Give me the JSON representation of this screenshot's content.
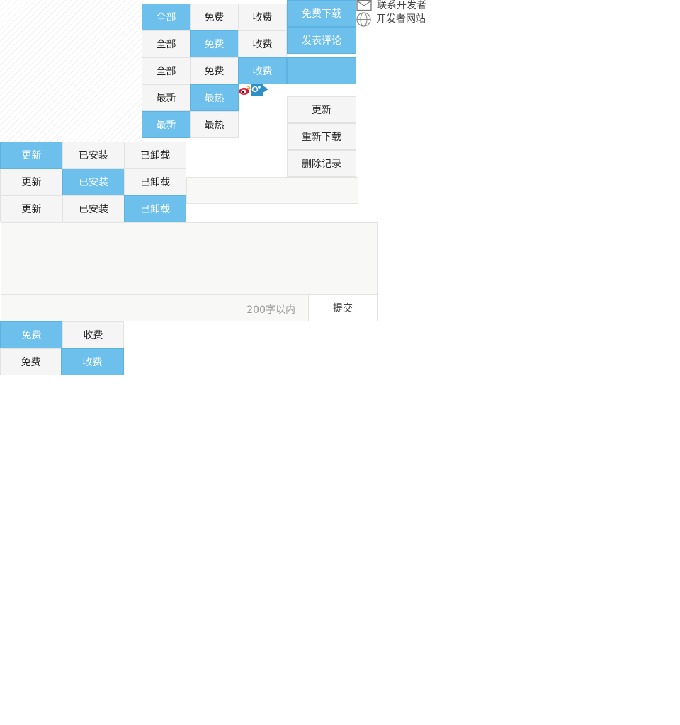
{
  "filter_all": {
    "rows": [
      {
        "all": "全部",
        "free": "免费",
        "paid": "收费",
        "active": "all"
      },
      {
        "all": "全部",
        "free": "免费",
        "paid": "收费",
        "active": "free"
      },
      {
        "all": "全部",
        "free": "免费",
        "paid": "收费",
        "active": "paid"
      }
    ]
  },
  "sort_tabs": {
    "rows": [
      {
        "newest": "最新",
        "hottest": "最热",
        "active": "hottest"
      },
      {
        "newest": "最新",
        "hottest": "最热",
        "active": "newest"
      }
    ]
  },
  "actions": {
    "download": "免费下载",
    "comment": "发表评论",
    "blank": ""
  },
  "developer": {
    "contact": "联系开发者",
    "website": "开发者网站"
  },
  "record_menu": {
    "update": "更新",
    "redownload": "重新下载",
    "delete": "删除记录"
  },
  "install_tabs": {
    "rows": [
      {
        "update": "更新",
        "installed": "已安装",
        "uninstalled": "已卸载",
        "active": "update"
      },
      {
        "update": "更新",
        "installed": "已安装",
        "uninstalled": "已卸载",
        "active": "installed"
      },
      {
        "update": "更新",
        "installed": "已安装",
        "uninstalled": "已卸载",
        "active": "uninstalled"
      }
    ]
  },
  "comment_box": {
    "value": "",
    "hint": "200字以内",
    "submit": "提交"
  },
  "price_tabs": {
    "rows": [
      {
        "free": "免费",
        "paid": "收费",
        "active": "free"
      },
      {
        "free": "免费",
        "paid": "收费",
        "active": "paid"
      }
    ]
  },
  "share": {
    "icons": [
      "weibo-icon",
      "tencent-weibo-icon"
    ]
  },
  "colors": {
    "accent": "#6dbfec",
    "button_bg": "#f4f5f4",
    "border": "#e1e3e1"
  }
}
